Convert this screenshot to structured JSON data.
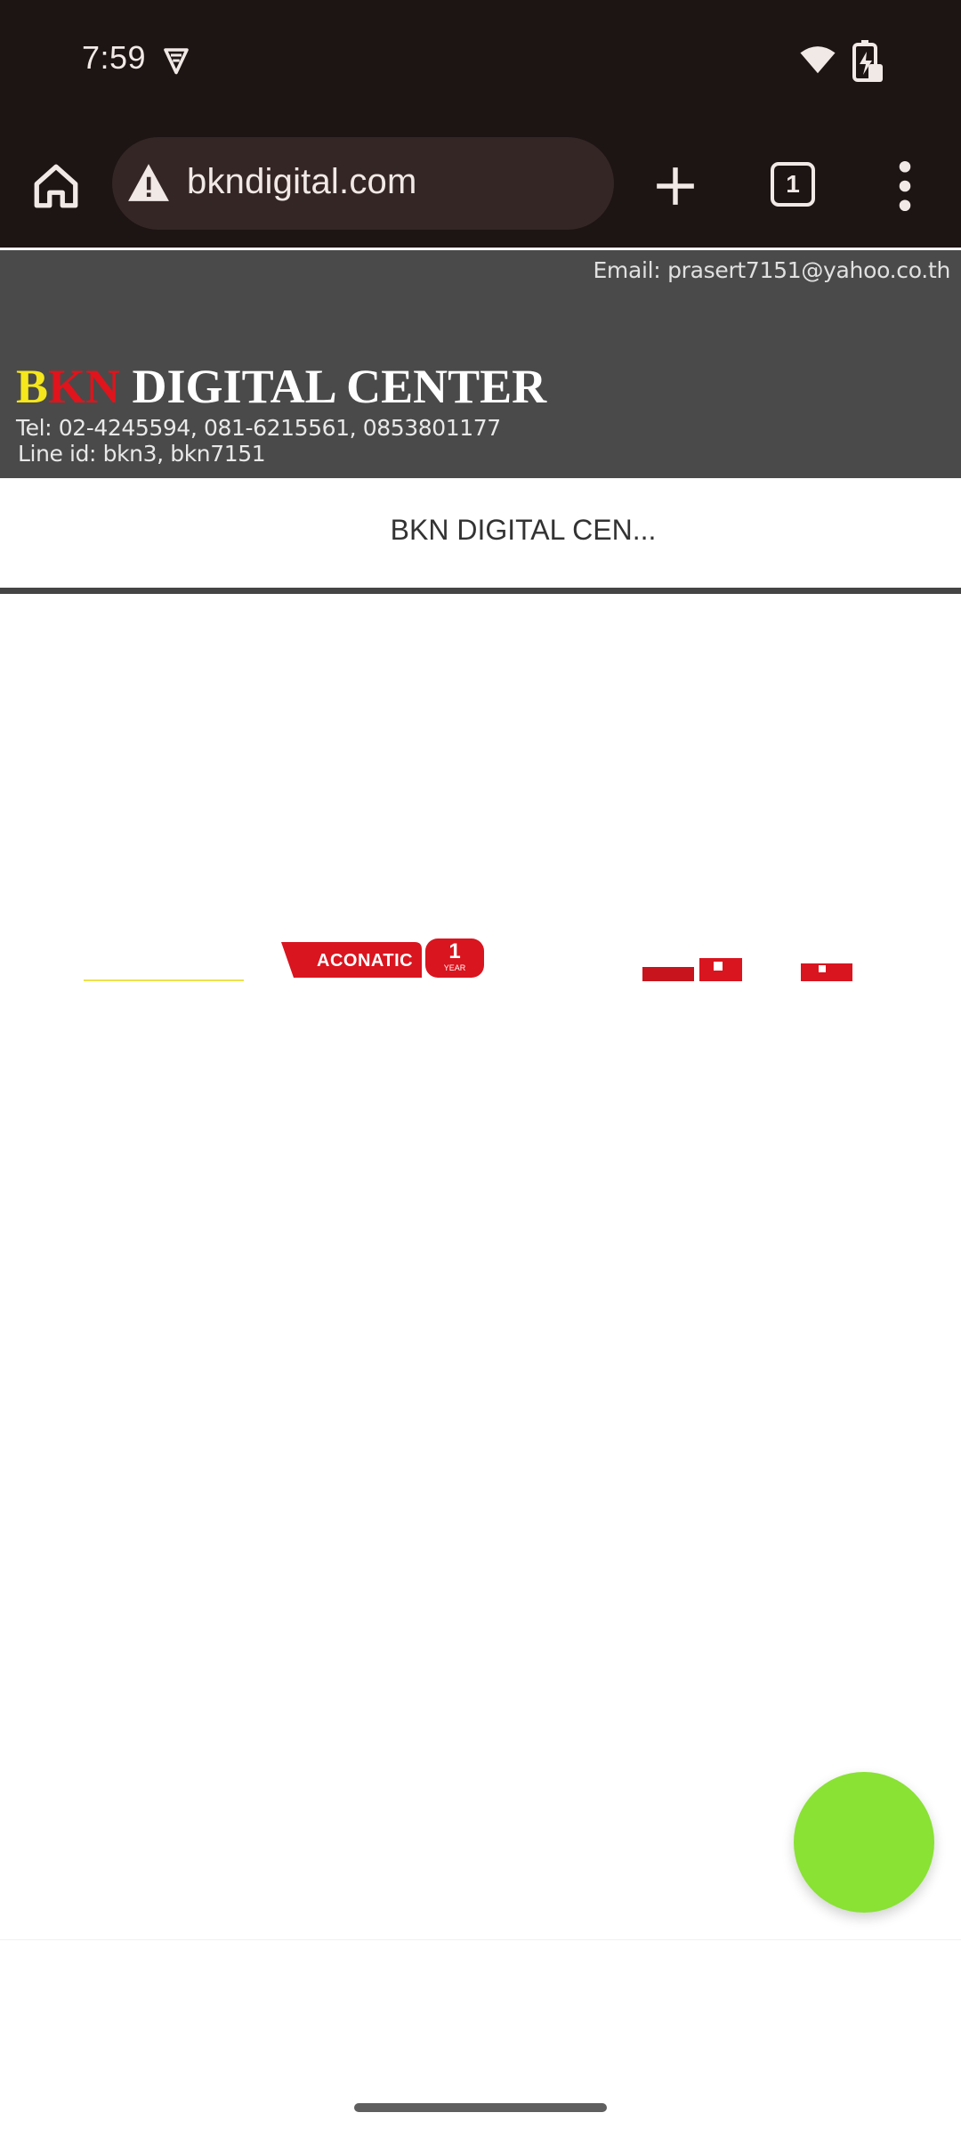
{
  "status_bar": {
    "time": "7:59",
    "icons": [
      "vpn-shield-icon",
      "wifi-icon",
      "battery-charging-icon"
    ]
  },
  "browser": {
    "url": "bkndigital.com",
    "tab_count": "1",
    "page_load_progress": 0.7,
    "icons": [
      "home-icon",
      "warning-icon",
      "plus-icon",
      "tabs-icon",
      "menu-icon"
    ]
  },
  "site": {
    "email": "Email: prasert7151@yahoo.co.th",
    "brand": {
      "part1": "B",
      "part2": "K",
      "part3": "N",
      "rest": " DIGITAL CENTER",
      "colors": {
        "b": "#f5e71c",
        "kn": "#e0141c",
        "rest": "#ffffff"
      }
    },
    "tel": "Tel: 02-4245594, 081-6215561, 0853801177",
    "line_id": "Line id: bkn3, bkn7151",
    "header_bg": "#4a4a4a"
  },
  "nav": {
    "title": "BKN DIGITAL CEN..."
  },
  "banner": {
    "logo_text": "ACONATIC",
    "badge_number": "1",
    "badge_word": "YEAR",
    "accent": "#d9151f"
  },
  "fab": {
    "color": "#89e234"
  }
}
